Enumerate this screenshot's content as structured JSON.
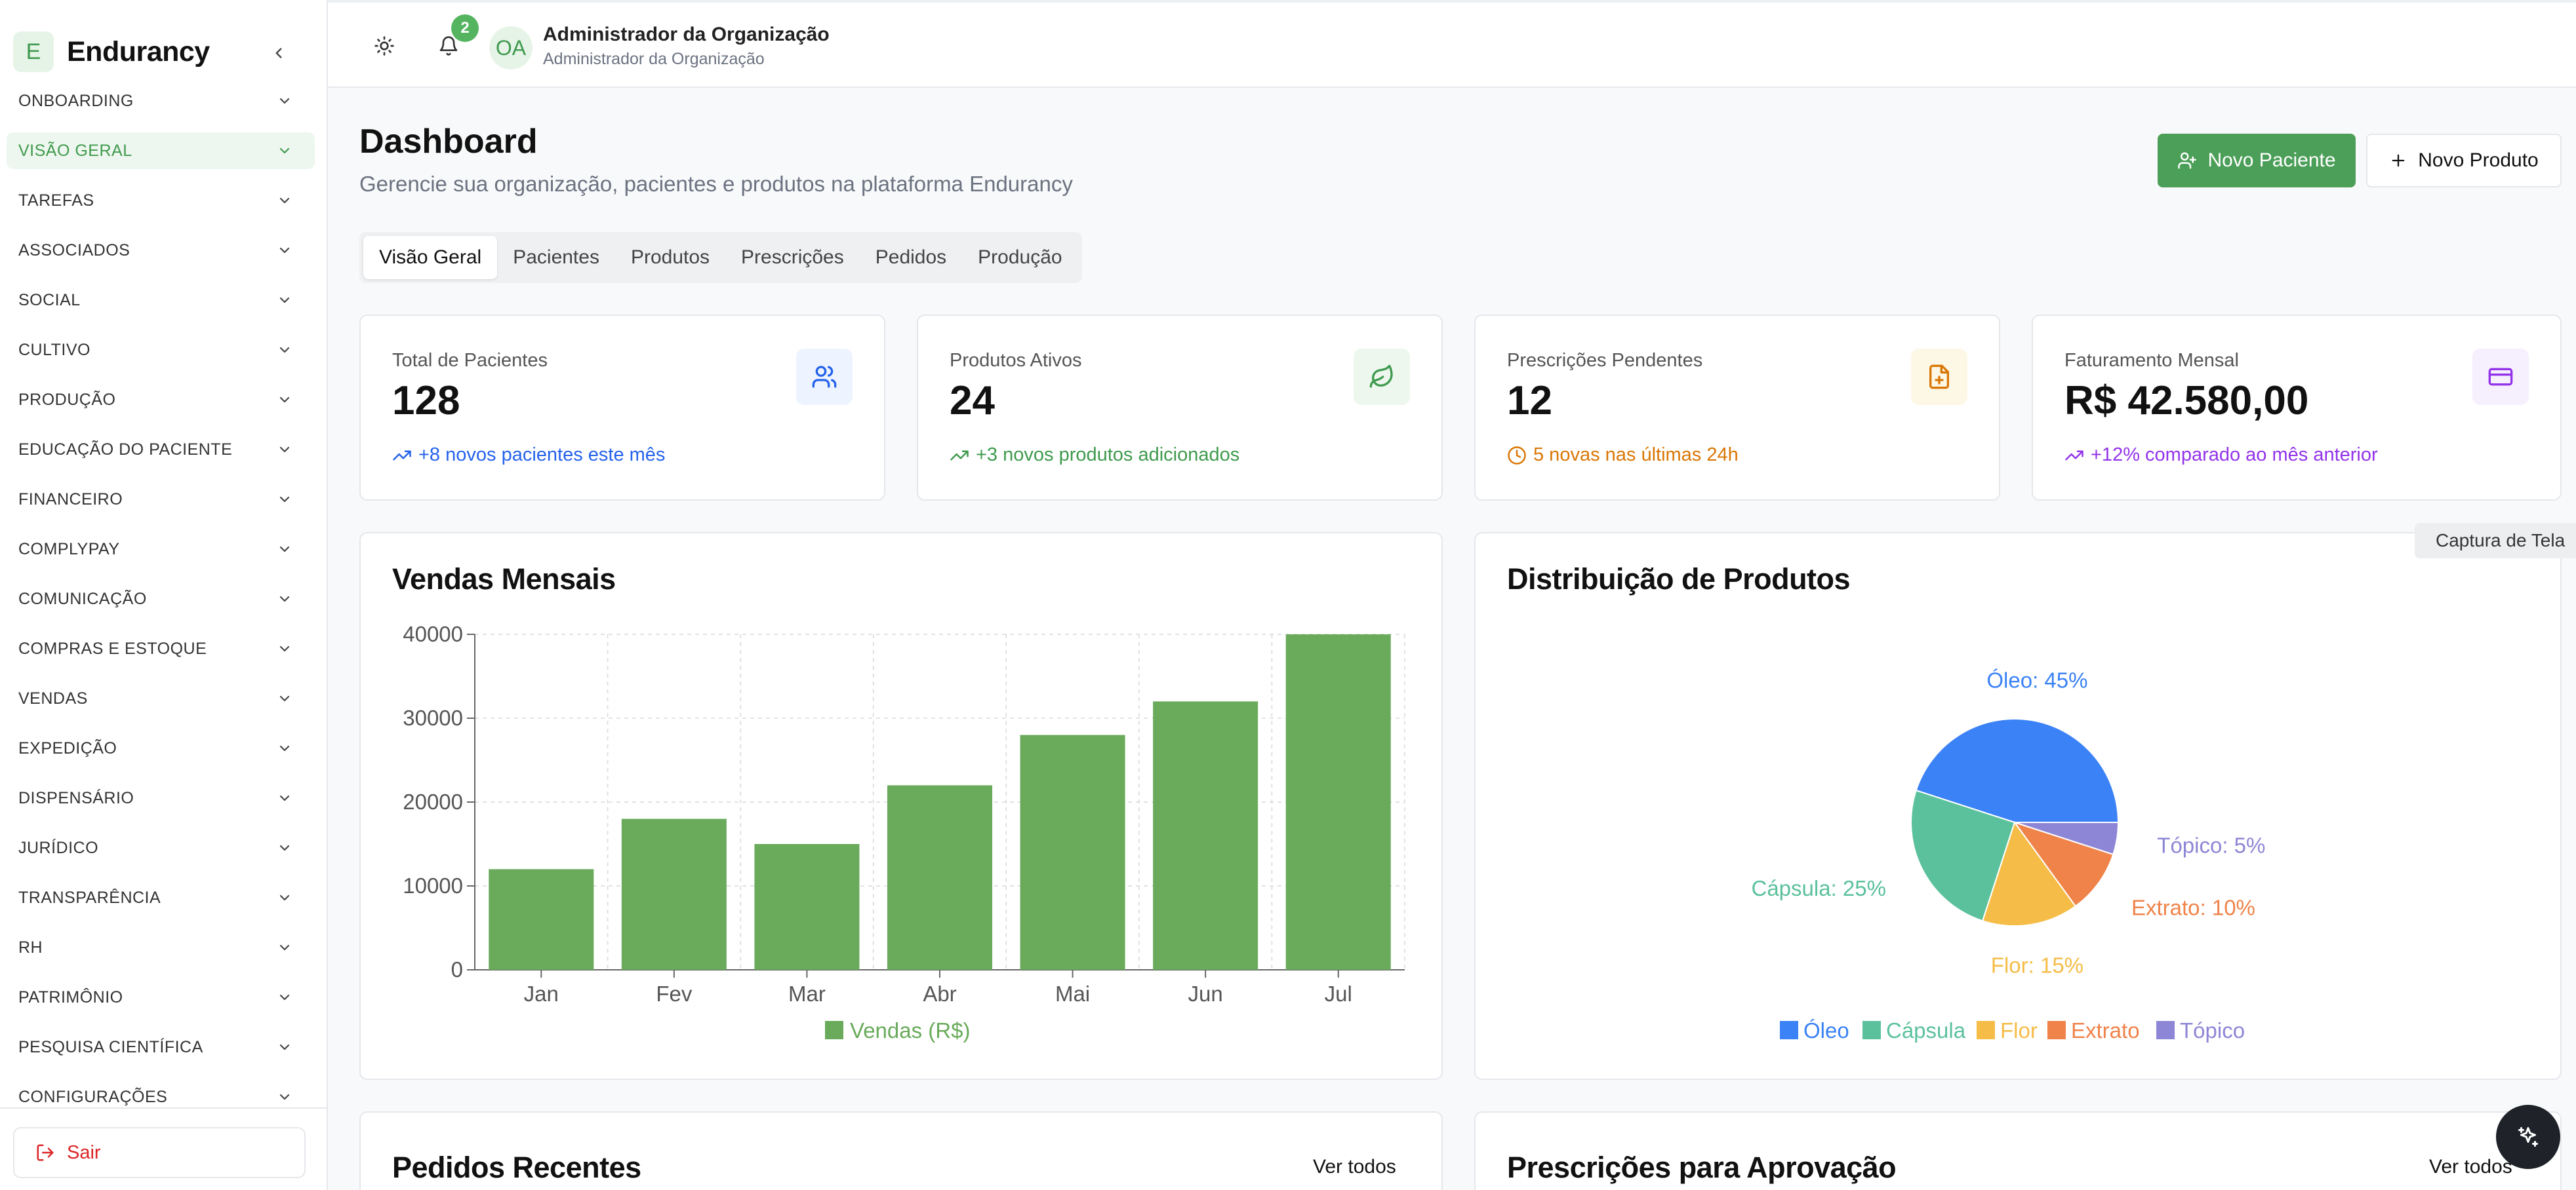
{
  "sidebar": {
    "brand_letter": "E",
    "brand_name": "Endurancy",
    "items": [
      {
        "label": "ONBOARDING",
        "active": false
      },
      {
        "label": "VISÃO GERAL",
        "active": true
      },
      {
        "label": "TAREFAS",
        "active": false
      },
      {
        "label": "ASSOCIADOS",
        "active": false
      },
      {
        "label": "SOCIAL",
        "active": false
      },
      {
        "label": "CULTIVO",
        "active": false
      },
      {
        "label": "PRODUÇÃO",
        "active": false
      },
      {
        "label": "EDUCAÇÃO DO PACIENTE",
        "active": false
      },
      {
        "label": "FINANCEIRO",
        "active": false
      },
      {
        "label": "COMPLYPAY",
        "active": false
      },
      {
        "label": "COMUNICAÇÃO",
        "active": false
      },
      {
        "label": "COMPRAS E ESTOQUE",
        "active": false
      },
      {
        "label": "VENDAS",
        "active": false
      },
      {
        "label": "EXPEDIÇÃO",
        "active": false
      },
      {
        "label": "DISPENSÁRIO",
        "active": false
      },
      {
        "label": "JURÍDICO",
        "active": false
      },
      {
        "label": "TRANSPARÊNCIA",
        "active": false
      },
      {
        "label": "RH",
        "active": false
      },
      {
        "label": "PATRIMÔNIO",
        "active": false
      },
      {
        "label": "PESQUISA CIENTÍFICA",
        "active": false
      },
      {
        "label": "CONFIGURAÇÕES",
        "active": false
      }
    ],
    "logout_label": "Sair"
  },
  "header": {
    "notification_count": "2",
    "avatar_initials": "OA",
    "user_name": "Administrador da Organização",
    "user_role": "Administrador da Organização"
  },
  "main": {
    "title": "Dashboard",
    "subtitle": "Gerencie sua organização, pacientes e produtos na plataforma Endurancy",
    "new_patient_label": "Novo Paciente",
    "new_product_label": "Novo Produto",
    "tabs": [
      {
        "label": "Visão Geral",
        "active": true
      },
      {
        "label": "Pacientes",
        "active": false
      },
      {
        "label": "Produtos",
        "active": false
      },
      {
        "label": "Prescrições",
        "active": false
      },
      {
        "label": "Pedidos",
        "active": false
      },
      {
        "label": "Produção",
        "active": false
      }
    ],
    "stats": [
      {
        "label": "Total de Pacientes",
        "value": "128",
        "trend": "+8 novos pacientes este mês",
        "icon": "users-icon",
        "color": "#2563eb",
        "bg": "#eef4ff"
      },
      {
        "label": "Produtos Ativos",
        "value": "24",
        "trend": "+3 novos produtos adicionados",
        "icon": "leaf-icon",
        "color": "#3f9a4d",
        "bg": "#edf7ee"
      },
      {
        "label": "Prescrições Pendentes",
        "value": "12",
        "trend": "5 novas nas últimas 24h",
        "icon": "file-plus-icon",
        "color": "#d97706",
        "bg": "#fdf7e6"
      },
      {
        "label": "Faturamento Mensal",
        "value": "R$ 42.580,00",
        "trend": "+12% comparado ao mês anterior",
        "icon": "credit-card-icon",
        "color": "#9333ea",
        "bg": "#f6effd"
      }
    ],
    "sales_card_title": "Vendas Mensais",
    "distribution_card_title": "Distribuição de Produtos",
    "recent_orders_title": "Pedidos Recentes",
    "prescriptions_title": "Prescrições para Aprovação",
    "see_all_label": "Ver todos"
  },
  "tooltip": "Captura de Tela",
  "chart_data": [
    {
      "type": "bar",
      "title": "Vendas Mensais",
      "categories": [
        "Jan",
        "Fev",
        "Mar",
        "Abr",
        "Mai",
        "Jun",
        "Jul"
      ],
      "series": [
        {
          "name": "Vendas (R$)",
          "values": [
            12000,
            18000,
            15000,
            22000,
            28000,
            32000,
            40000
          ],
          "color": "#69ab5b"
        }
      ],
      "ylim": [
        0,
        40000
      ],
      "yticks": [
        0,
        10000,
        20000,
        30000,
        40000
      ],
      "grid": true,
      "legend": "bottom"
    },
    {
      "type": "pie",
      "title": "Distribuição de Produtos",
      "slices": [
        {
          "name": "Óleo",
          "value": 45,
          "label": "Óleo: 45%",
          "color": "#3b82f6"
        },
        {
          "name": "Cápsula",
          "value": 25,
          "label": "Cápsula: 25%",
          "color": "#5bc19c"
        },
        {
          "name": "Flor",
          "value": 15,
          "label": "Flor: 15%",
          "color": "#f5bd47"
        },
        {
          "name": "Extrato",
          "value": 10,
          "label": "Extrato: 10%",
          "color": "#ef8349"
        },
        {
          "name": "Tópico",
          "value": 5,
          "label": "Tópico: 5%",
          "color": "#8d86d6"
        }
      ],
      "legend": "bottom"
    }
  ]
}
